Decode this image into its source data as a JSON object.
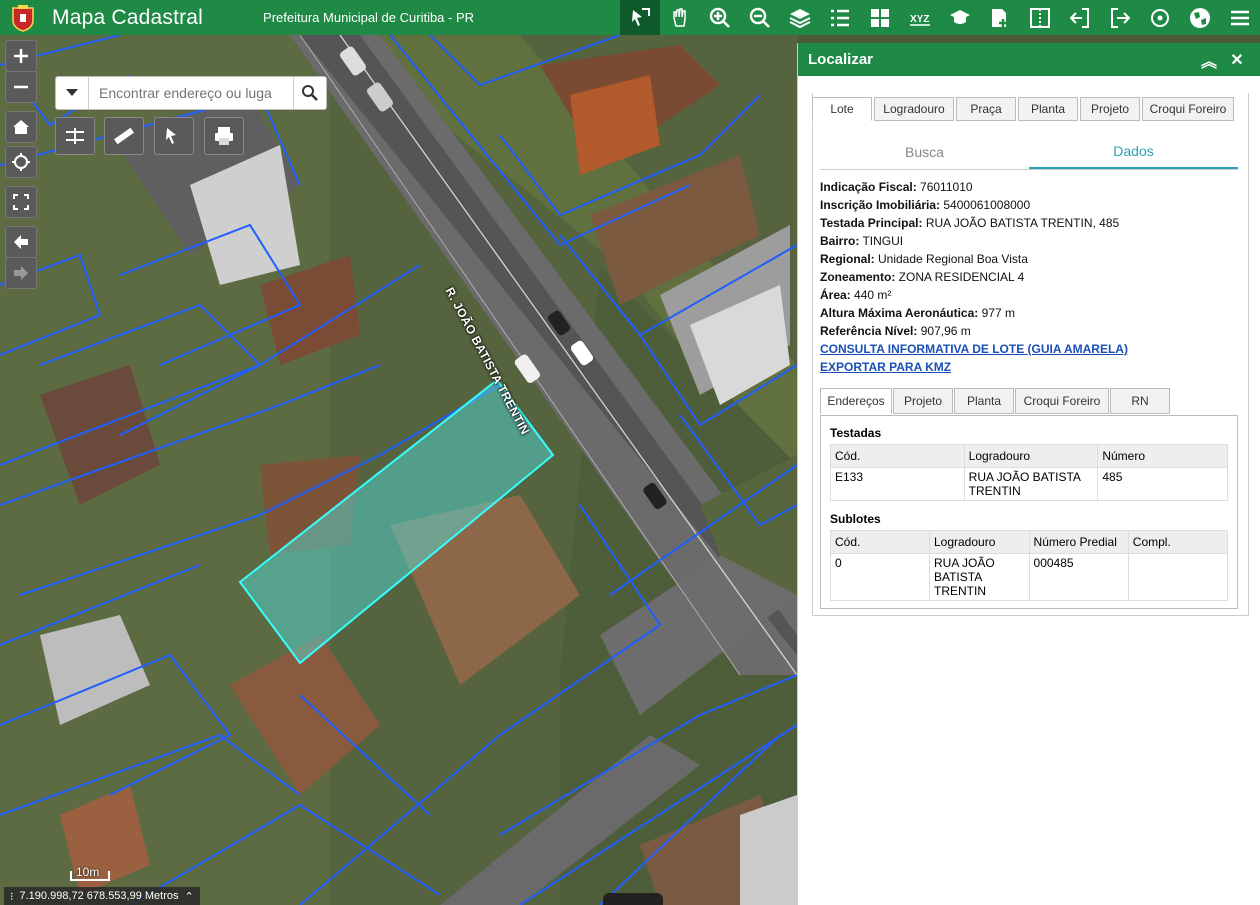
{
  "header": {
    "title": "Mapa Cadastral",
    "subtitle": "Prefeitura Municipal de Curitiba - PR"
  },
  "toolbar": [
    "identify-icon",
    "pan-icon",
    "zoom-in-icon",
    "zoom-out-icon",
    "layers-icon",
    "legend-icon",
    "basemap-icon",
    "xyz-icon",
    "education-icon",
    "add-data-icon",
    "compare-icon",
    "import-icon",
    "export-icon",
    "location-icon",
    "globe-icon",
    "menu-icon"
  ],
  "map": {
    "search_placeholder": "Encontrar endereço ou luga",
    "street_label": "R. JOÃO BATISTA TRENTIN",
    "scale_label": "10m",
    "coords": "7.190.998,72 678.553,99 Metros"
  },
  "panel": {
    "title": "Localizar",
    "tabs": [
      "Lote",
      "Logradouro",
      "Praça",
      "Planta",
      "Projeto",
      "Croqui Foreiro"
    ],
    "subtabs": [
      "Busca",
      "Dados"
    ],
    "fields": [
      {
        "label": "Indicação Fiscal:",
        "value": "76011010"
      },
      {
        "label": "Inscrição Imobiliária:",
        "value": "5400061008000"
      },
      {
        "label": "Testada Principal:",
        "value": "RUA JOÃO BATISTA TRENTIN, 485"
      },
      {
        "label": "Bairro:",
        "value": "TINGUI"
      },
      {
        "label": "Regional:",
        "value": "Unidade Regional Boa Vista"
      },
      {
        "label": "Zoneamento:",
        "value": "ZONA RESIDENCIAL 4"
      },
      {
        "label": "Área:",
        "value": "440 m²"
      },
      {
        "label": "Altura Máxima Aeronáutica:",
        "value": "977 m"
      },
      {
        "label": "Referência Nível:",
        "value": "907,96 m"
      }
    ],
    "links": [
      "CONSULTA INFORMATIVA DE LOTE (GUIA AMARELA)",
      "EXPORTAR PARA KMZ"
    ],
    "tabs2": [
      "Endereços",
      "Projeto",
      "Planta",
      "Croqui Foreiro",
      "RN"
    ],
    "testadas": {
      "title": "Testadas",
      "headers": [
        "Cód.",
        "Logradouro",
        "Número"
      ],
      "rows": [
        [
          "E133",
          "RUA JOÃO BATISTA TRENTIN",
          "485"
        ]
      ]
    },
    "sublotes": {
      "title": "Sublotes",
      "headers": [
        "Cód.",
        "Logradouro",
        "Número Predial",
        "Compl."
      ],
      "rows": [
        [
          "0",
          "RUA JOÃO BATISTA TRENTIN",
          "000485",
          ""
        ]
      ]
    }
  }
}
